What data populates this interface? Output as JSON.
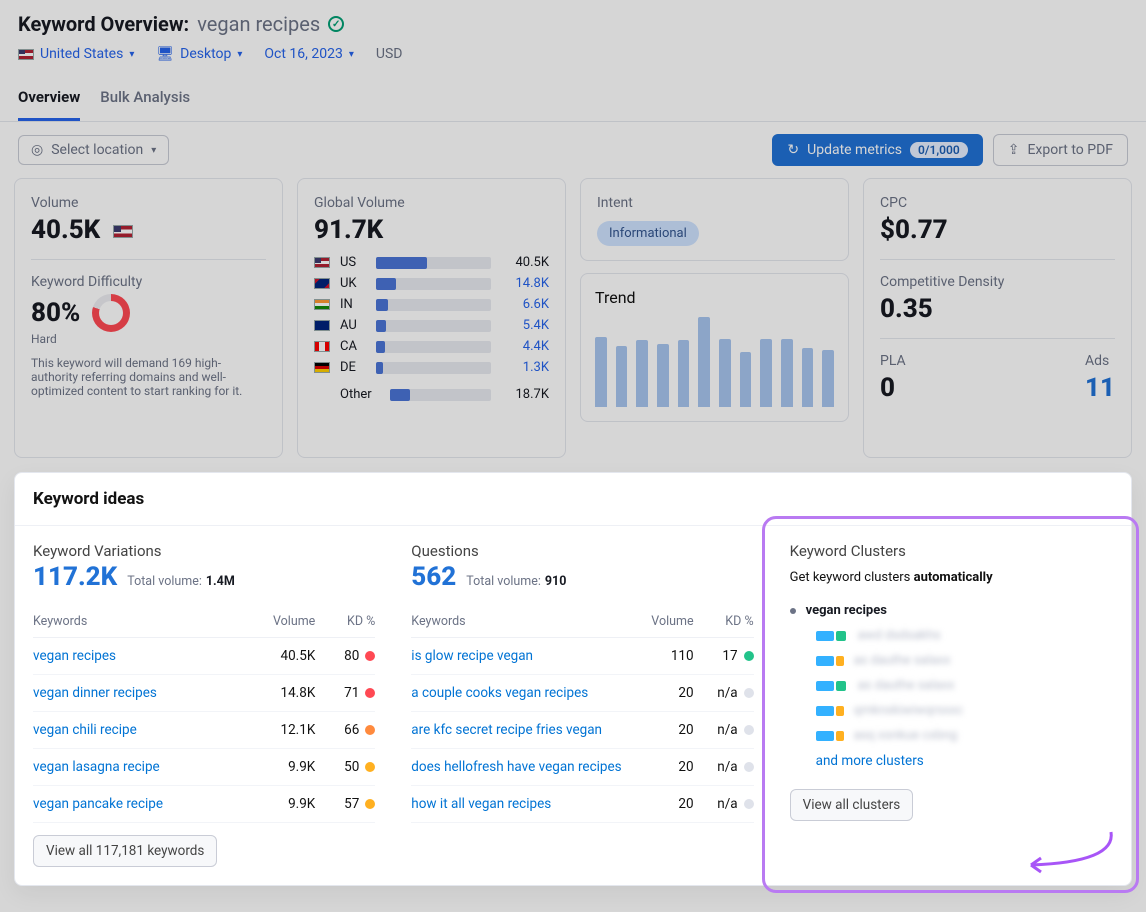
{
  "header": {
    "title_prefix": "Keyword Overview:",
    "keyword": "vegan recipes",
    "country_label": "United States",
    "device_label": "Desktop",
    "date_label": "Oct 16, 2023",
    "currency_label": "USD"
  },
  "tabs": {
    "overview": "Overview",
    "bulk": "Bulk Analysis"
  },
  "toolbar": {
    "select_location": "Select location",
    "update_metrics": "Update metrics",
    "update_pill": "0/1,000",
    "export": "Export to PDF"
  },
  "volume_card": {
    "label": "Volume",
    "value": "40.5K",
    "kd_label": "Keyword Difficulty",
    "kd_value": "80%",
    "kd_word": "Hard",
    "kd_desc": "This keyword will demand 169 high-authority referring domains and well-optimized content to start ranking for it."
  },
  "global_volume": {
    "label": "Global Volume",
    "value": "91.7K",
    "rows": [
      {
        "flag": "us",
        "cc": "US",
        "val": "40.5K",
        "pct": 44,
        "link": false
      },
      {
        "flag": "uk",
        "cc": "UK",
        "val": "14.8K",
        "pct": 17,
        "link": true
      },
      {
        "flag": "in",
        "cc": "IN",
        "val": "6.6K",
        "pct": 10,
        "link": true
      },
      {
        "flag": "au",
        "cc": "AU",
        "val": "5.4K",
        "pct": 9,
        "link": true
      },
      {
        "flag": "ca",
        "cc": "CA",
        "val": "4.4K",
        "pct": 8,
        "link": true
      },
      {
        "flag": "de",
        "cc": "DE",
        "val": "1.3K",
        "pct": 6,
        "link": true
      }
    ],
    "other_label": "Other",
    "other_val": "18.7K",
    "other_pct": 20
  },
  "intent": {
    "label": "Intent",
    "value": "Informational"
  },
  "trend": {
    "label": "Trend"
  },
  "cpc": {
    "label": "CPC",
    "value": "$0.77",
    "cd_label": "Competitive Density",
    "cd_value": "0.35",
    "pla_label": "PLA",
    "pla_value": "0",
    "ads_label": "Ads",
    "ads_value": "11"
  },
  "chart_data": {
    "type": "bar",
    "title": "Trend",
    "categories": [
      "1",
      "2",
      "3",
      "4",
      "5",
      "6",
      "7",
      "8",
      "9",
      "10",
      "11",
      "12"
    ],
    "values": [
      72,
      62,
      68,
      64,
      68,
      92,
      70,
      56,
      70,
      70,
      60,
      58
    ],
    "ylim": [
      0,
      100
    ]
  },
  "ideas": {
    "title": "Keyword ideas",
    "variations": {
      "title": "Keyword Variations",
      "count": "117.2K",
      "total_label": "Total volume:",
      "total_value": "1.4M",
      "headers": {
        "kw": "Keywords",
        "vol": "Volume",
        "kd": "KD %"
      },
      "rows": [
        {
          "kw": "vegan recipes",
          "vol": "40.5K",
          "kd": "80",
          "color": "#ff4953"
        },
        {
          "kw": "vegan dinner recipes",
          "vol": "14.8K",
          "kd": "71",
          "color": "#ff4953"
        },
        {
          "kw": "vegan chili recipe",
          "vol": "12.1K",
          "kd": "66",
          "color": "#ff8a3d"
        },
        {
          "kw": "vegan lasagna recipe",
          "vol": "9.9K",
          "kd": "50",
          "color": "#ffb020"
        },
        {
          "kw": "vegan pancake recipe",
          "vol": "9.9K",
          "kd": "57",
          "color": "#ffb020"
        }
      ],
      "view_all": "View all 117,181 keywords"
    },
    "questions": {
      "title": "Questions",
      "count": "562",
      "total_label": "Total volume:",
      "total_value": "910",
      "headers": {
        "kw": "Keywords",
        "vol": "Volume",
        "kd": "KD %"
      },
      "rows": [
        {
          "kw": "is glow recipe vegan",
          "vol": "110",
          "kd": "17",
          "color": "#22c38a"
        },
        {
          "kw": "a couple cooks vegan recipes",
          "vol": "20",
          "kd": "n/a",
          "color": "na"
        },
        {
          "kw": "are kfc secret recipe fries vegan",
          "vol": "20",
          "kd": "n/a",
          "color": "na"
        },
        {
          "kw": "does hellofresh have vegan recipes",
          "vol": "20",
          "kd": "n/a",
          "color": "na"
        },
        {
          "kw": "how it all vegan recipes",
          "vol": "20",
          "kd": "n/a",
          "color": "na"
        }
      ]
    },
    "clusters": {
      "title": "Keyword Clusters",
      "subtitle_a": "Get keyword clusters ",
      "subtitle_b": "automatically",
      "root": "vegan recipes",
      "more": "and more clusters",
      "view_all": "View all clusters"
    }
  }
}
